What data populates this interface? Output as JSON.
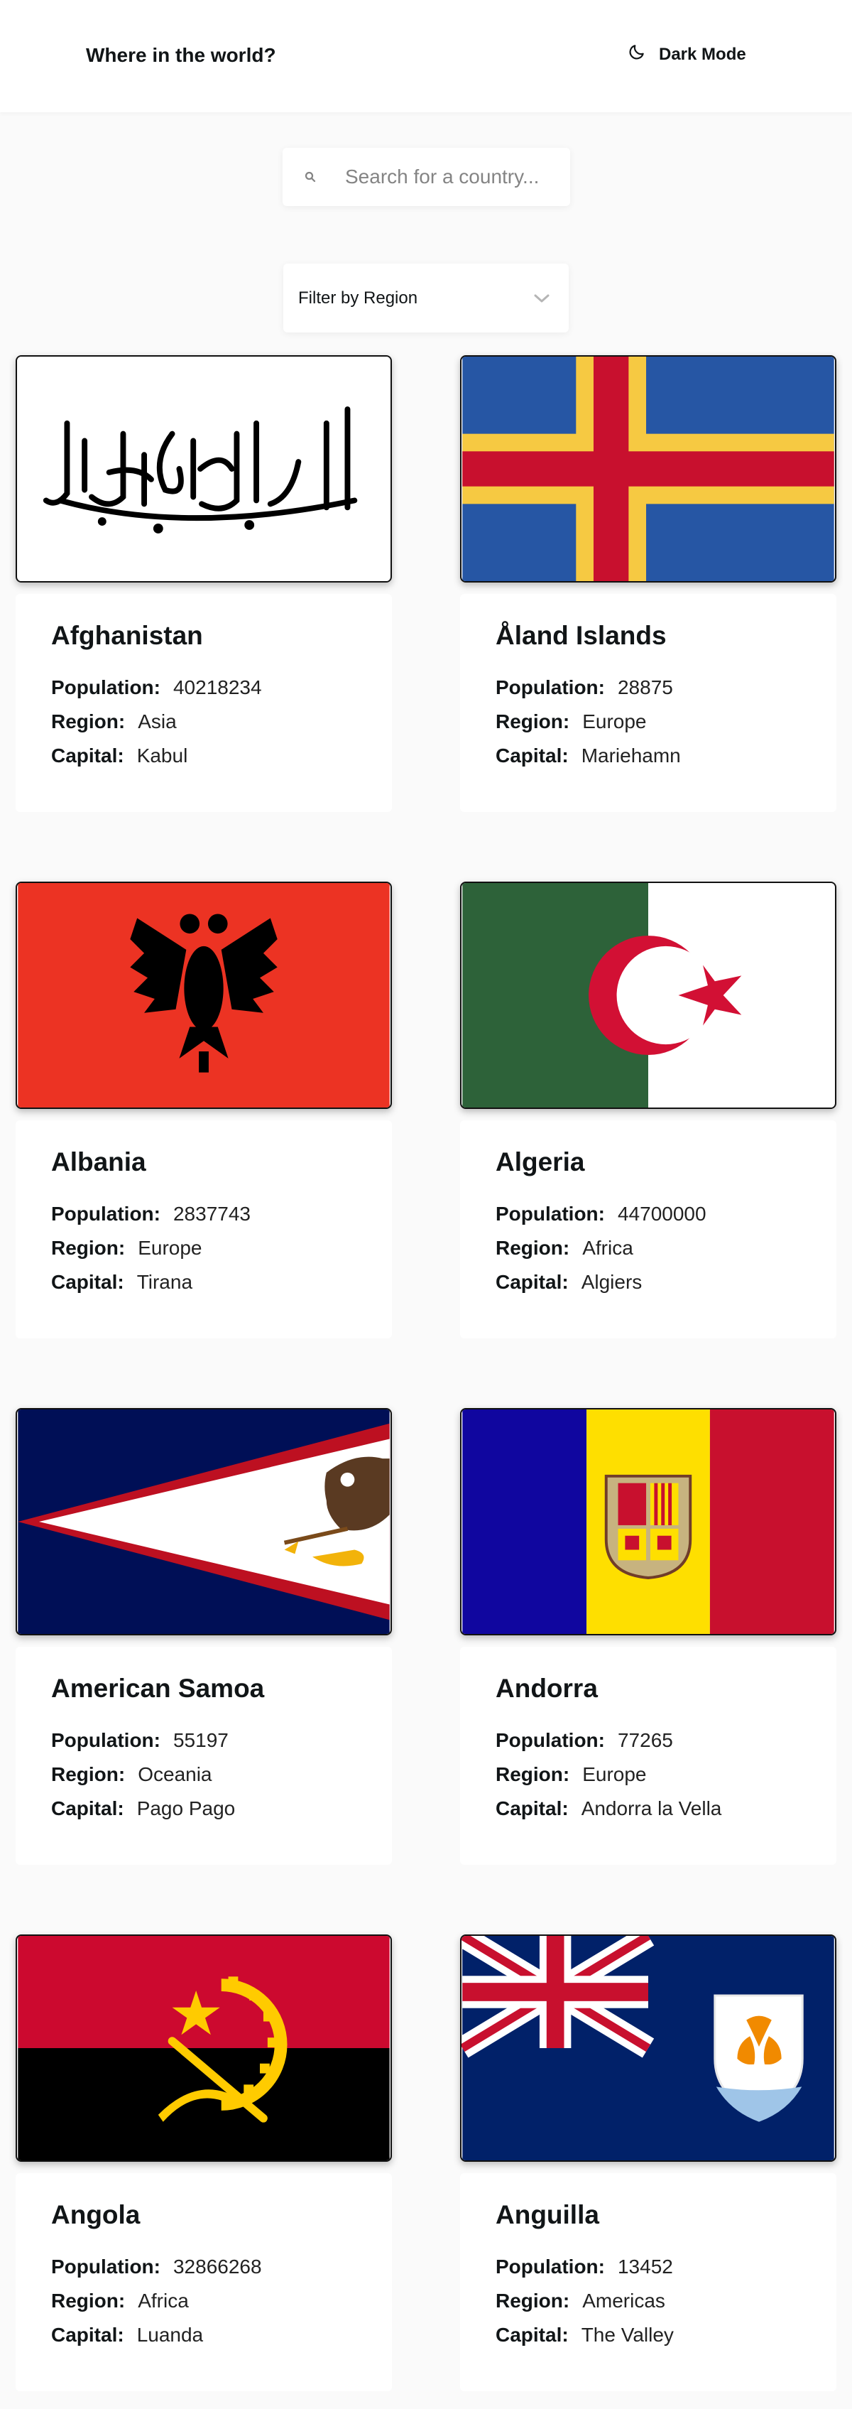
{
  "header": {
    "title": "Where in the world?",
    "theme_toggle_label": "Dark Mode"
  },
  "search": {
    "placeholder": "Search for a country..."
  },
  "filter": {
    "label": "Filter by Region"
  },
  "labels": {
    "population": "Population:",
    "region": "Region:",
    "capital": "Capital:"
  },
  "countries": [
    {
      "name": "Afghanistan",
      "population": "40218234",
      "region": "Asia",
      "capital": "Kabul",
      "flag_lettering": "لا إله إلا الله محمد رسول الله"
    },
    {
      "name": "Åland Islands",
      "population": "28875",
      "region": "Europe",
      "capital": "Mariehamn"
    },
    {
      "name": "Albania",
      "population": "2837743",
      "region": "Europe",
      "capital": "Tirana"
    },
    {
      "name": "Algeria",
      "population": "44700000",
      "region": "Africa",
      "capital": "Algiers"
    },
    {
      "name": "American Samoa",
      "population": "55197",
      "region": "Oceania",
      "capital": "Pago Pago"
    },
    {
      "name": "Andorra",
      "population": "77265",
      "region": "Europe",
      "capital": "Andorra la Vella"
    },
    {
      "name": "Angola",
      "population": "32866268",
      "region": "Africa",
      "capital": "Luanda"
    },
    {
      "name": "Anguilla",
      "population": "13452",
      "region": "Americas",
      "capital": "The Valley"
    }
  ],
  "colors": {
    "page_bg": "#fafafa",
    "card_bg": "#ffffff",
    "text": "#111517",
    "placeholder": "#848484"
  },
  "icons": {
    "theme": "moon-icon",
    "search": "search-icon",
    "filter": "chevron-down-icon"
  }
}
